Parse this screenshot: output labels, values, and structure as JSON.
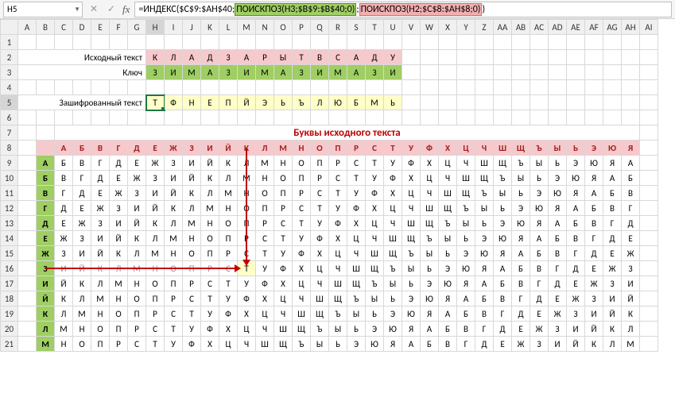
{
  "cellRef": "H5",
  "formula": {
    "p1": "=ИНДЕКС($C$9:$AH$40;",
    "p2": "ПОИСКПОЗ(H3;$B$9:$B$40;0)",
    "p3": ";",
    "p4": "ПОИСКПОЗ(H2;$C$8:$AH$8;0)",
    "p5": ")"
  },
  "fx": "fx",
  "labels": {
    "src": "Исходный текст",
    "key": "Ключ",
    "cipher": "Зашифрованный текст",
    "title": "Буквы исходного текста"
  },
  "columns": [
    "",
    "A",
    "B",
    "C",
    "D",
    "E",
    "F",
    "G",
    "H",
    "I",
    "J",
    "K",
    "L",
    "M",
    "N",
    "O",
    "P",
    "Q",
    "R",
    "S",
    "T",
    "U",
    "V",
    "W",
    "X",
    "Y",
    "Z",
    "AA",
    "AB",
    "AC",
    "AD",
    "AE",
    "AF",
    "AG",
    "AH",
    "AI"
  ],
  "rowNums": [
    "1",
    "2",
    "3",
    "4",
    "5",
    "6",
    "7",
    "8",
    "9",
    "10",
    "11",
    "12",
    "13",
    "14",
    "15",
    "16",
    "17",
    "18",
    "19",
    "20",
    "21"
  ],
  "srcText": [
    "К",
    "Л",
    "А",
    "Д",
    "З",
    "А",
    "Р",
    "Ы",
    "Т",
    "В",
    "С",
    "А",
    "Д",
    "У"
  ],
  "keyText": [
    "З",
    "И",
    "М",
    "А",
    "З",
    "И",
    "М",
    "А",
    "З",
    "И",
    "М",
    "А",
    "З",
    "И"
  ],
  "cipher": [
    "Т",
    "Ф",
    "Н",
    "Е",
    "П",
    "Й",
    "Э",
    "Ь",
    "Ъ",
    "Л",
    "Ю",
    "Б",
    "М",
    "Ь"
  ],
  "alphaHeader": [
    "А",
    "Б",
    "В",
    "Г",
    "Д",
    "Е",
    "Ж",
    "З",
    "И",
    "Й",
    "К",
    "Л",
    "М",
    "Н",
    "О",
    "П",
    "Р",
    "С",
    "Т",
    "У",
    "Ф",
    "Х",
    "Ц",
    "Ч",
    "Ш",
    "Щ",
    "Ъ",
    "Ы",
    "Ь",
    "Э",
    "Ю",
    "Я"
  ],
  "rowLabels": [
    "А",
    "Б",
    "В",
    "Г",
    "Д",
    "Е",
    "Ж",
    "З",
    "И",
    "Й",
    "К",
    "Л",
    "М"
  ],
  "chart_data": {
    "type": "table",
    "title": "Vigenère table (Russian alphabet, 32 letters, header row А–Я, key rows А–М)",
    "columns": [
      "А",
      "Б",
      "В",
      "Г",
      "Д",
      "Е",
      "Ж",
      "З",
      "И",
      "Й",
      "К",
      "Л",
      "М",
      "Н",
      "О",
      "П",
      "Р",
      "С",
      "Т",
      "У",
      "Ф",
      "Х",
      "Ц",
      "Ч",
      "Ш",
      "Щ",
      "Ъ",
      "Ы",
      "Ь",
      "Э",
      "Ю",
      "Я"
    ],
    "rows": {
      "А": [
        "Б",
        "В",
        "Г",
        "Д",
        "Е",
        "Ж",
        "З",
        "И",
        "Й",
        "К",
        "Л",
        "М",
        "Н",
        "О",
        "П",
        "Р",
        "С",
        "Т",
        "У",
        "Ф",
        "Х",
        "Ц",
        "Ч",
        "Ш",
        "Щ",
        "Ъ",
        "Ы",
        "Ь",
        "Э",
        "Ю",
        "Я",
        "А"
      ],
      "Б": [
        "В",
        "Г",
        "Д",
        "Е",
        "Ж",
        "З",
        "И",
        "Й",
        "К",
        "Л",
        "М",
        "Н",
        "О",
        "П",
        "Р",
        "С",
        "Т",
        "У",
        "Ф",
        "Х",
        "Ц",
        "Ч",
        "Ш",
        "Щ",
        "Ъ",
        "Ы",
        "Ь",
        "Э",
        "Ю",
        "Я",
        "А",
        "Б"
      ],
      "В": [
        "Г",
        "Д",
        "Е",
        "Ж",
        "З",
        "И",
        "Й",
        "К",
        "Л",
        "М",
        "Н",
        "О",
        "П",
        "Р",
        "С",
        "Т",
        "У",
        "Ф",
        "Х",
        "Ц",
        "Ч",
        "Ш",
        "Щ",
        "Ъ",
        "Ы",
        "Ь",
        "Э",
        "Ю",
        "Я",
        "А",
        "Б",
        "В"
      ],
      "Г": [
        "Д",
        "Е",
        "Ж",
        "З",
        "И",
        "Й",
        "К",
        "Л",
        "М",
        "Н",
        "О",
        "П",
        "Р",
        "С",
        "Т",
        "У",
        "Ф",
        "Х",
        "Ц",
        "Ч",
        "Ш",
        "Щ",
        "Ъ",
        "Ы",
        "Ь",
        "Э",
        "Ю",
        "Я",
        "А",
        "Б",
        "В",
        "Г"
      ],
      "Д": [
        "Е",
        "Ж",
        "З",
        "И",
        "Й",
        "К",
        "Л",
        "М",
        "Н",
        "О",
        "П",
        "Р",
        "С",
        "Т",
        "У",
        "Ф",
        "Х",
        "Ц",
        "Ч",
        "Ш",
        "Щ",
        "Ъ",
        "Ы",
        "Ь",
        "Э",
        "Ю",
        "Я",
        "А",
        "Б",
        "В",
        "Г",
        "Д"
      ],
      "Е": [
        "Ж",
        "З",
        "И",
        "Й",
        "К",
        "Л",
        "М",
        "Н",
        "О",
        "П",
        "Р",
        "С",
        "Т",
        "У",
        "Ф",
        "Х",
        "Ц",
        "Ч",
        "Ш",
        "Щ",
        "Ъ",
        "Ы",
        "Ь",
        "Э",
        "Ю",
        "Я",
        "А",
        "Б",
        "В",
        "Г",
        "Д",
        "Е"
      ],
      "Ж": [
        "З",
        "И",
        "Й",
        "К",
        "Л",
        "М",
        "Н",
        "О",
        "П",
        "Р",
        "С",
        "Т",
        "У",
        "Ф",
        "Х",
        "Ц",
        "Ч",
        "Ш",
        "Щ",
        "Ъ",
        "Ы",
        "Ь",
        "Э",
        "Ю",
        "Я",
        "А",
        "Б",
        "В",
        "Г",
        "Д",
        "Е",
        "Ж"
      ],
      "З": [
        "И",
        "Й",
        "К",
        "Л",
        "М",
        "Н",
        "О",
        "П",
        "Р",
        "С",
        "Т",
        "У",
        "Ф",
        "Х",
        "Ц",
        "Ч",
        "Ш",
        "Щ",
        "Ъ",
        "Ы",
        "Ь",
        "Э",
        "Ю",
        "Я",
        "А",
        "Б",
        "В",
        "Г",
        "Д",
        "Е",
        "Ж",
        "З"
      ],
      "И": [
        "Й",
        "К",
        "Л",
        "М",
        "Н",
        "О",
        "П",
        "Р",
        "С",
        "Т",
        "У",
        "Ф",
        "Х",
        "Ц",
        "Ч",
        "Ш",
        "Щ",
        "Ъ",
        "Ы",
        "Ь",
        "Э",
        "Ю",
        "Я",
        "А",
        "Б",
        "В",
        "Г",
        "Д",
        "Е",
        "Ж",
        "З",
        "И"
      ],
      "Й": [
        "К",
        "Л",
        "М",
        "Н",
        "О",
        "П",
        "Р",
        "С",
        "Т",
        "У",
        "Ф",
        "Х",
        "Ц",
        "Ч",
        "Ш",
        "Щ",
        "Ъ",
        "Ы",
        "Ь",
        "Э",
        "Ю",
        "Я",
        "А",
        "Б",
        "В",
        "Г",
        "Д",
        "Е",
        "Ж",
        "З",
        "И",
        "Й"
      ],
      "К": [
        "Л",
        "М",
        "Н",
        "О",
        "П",
        "Р",
        "С",
        "Т",
        "У",
        "Ф",
        "Х",
        "Ц",
        "Ч",
        "Ш",
        "Щ",
        "Ъ",
        "Ы",
        "Ь",
        "Э",
        "Ю",
        "Я",
        "А",
        "Б",
        "В",
        "Г",
        "Д",
        "Е",
        "Ж",
        "З",
        "И",
        "Й",
        "К"
      ],
      "Л": [
        "М",
        "Н",
        "О",
        "П",
        "Р",
        "С",
        "Т",
        "У",
        "Ф",
        "Х",
        "Ц",
        "Ч",
        "Ш",
        "Щ",
        "Ъ",
        "Ы",
        "Ь",
        "Э",
        "Ю",
        "Я",
        "А",
        "Б",
        "В",
        "Г",
        "Д",
        "Е",
        "Ж",
        "З",
        "И",
        "Й",
        "К",
        "Л"
      ],
      "М": [
        "Н",
        "О",
        "П",
        "Р",
        "С",
        "Т",
        "У",
        "Ф",
        "Х",
        "Ц",
        "Ч",
        "Ш",
        "Щ",
        "Ъ",
        "Ы",
        "Ь",
        "Э",
        "Ю",
        "Я",
        "А",
        "Б",
        "В",
        "Г",
        "Д",
        "Е",
        "Ж",
        "З",
        "И",
        "Й",
        "К",
        "Л",
        "М"
      ]
    }
  }
}
